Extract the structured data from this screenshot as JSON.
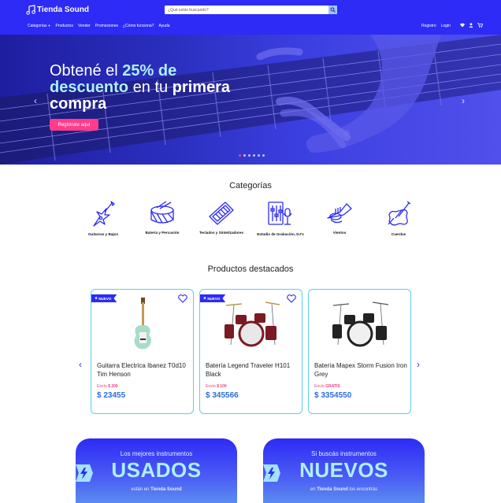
{
  "header": {
    "logo_text": "Tienda Sound",
    "search_placeholder": "¿Qué estás buscando?",
    "nav": [
      "Categorías",
      "Productos",
      "Vender",
      "Promociones",
      "¿Cómo funciona?",
      "Ayuda"
    ],
    "register": "Registro",
    "login": "Login"
  },
  "hero": {
    "line1_a": "Obtené el ",
    "line1_b": "25% de",
    "line2_a": "descuento",
    "line2_b": " en tu ",
    "line2_c": "primera",
    "line3": "compra",
    "button": "Registrate aquí",
    "slides": 6,
    "active_slide": 1
  },
  "categories": {
    "title": "Categorías",
    "items": [
      {
        "label": "Guitarras y Bajos",
        "icon": "guitar-icon"
      },
      {
        "label": "Batería y Percusión",
        "icon": "drum-icon"
      },
      {
        "label": "Teclados y Sintetizadores",
        "icon": "keyboard-icon"
      },
      {
        "label": "Estudio de Grabación, DJ's",
        "icon": "mixer-icon"
      },
      {
        "label": "Vientos",
        "icon": "trumpet-icon"
      },
      {
        "label": "Cuerdas",
        "icon": "violin-icon"
      }
    ]
  },
  "products": {
    "title": "Productos destacados",
    "items": [
      {
        "badge": "NUEVO",
        "name": "Guitarra Electrica Ibanez T0d10 Tim Henson",
        "ship_label": "Envío",
        "ship_value": "$ 200",
        "price": "$ 23455",
        "image": "guitar-photo"
      },
      {
        "badge": "NUEVO",
        "name": "Batería Legend Traveler H101 Black",
        "ship_label": "Envío",
        "ship_value": "$ 100",
        "price": "$ 345566",
        "image": "drum-kit-red-photo"
      },
      {
        "badge": "",
        "name": "Batería Mapex Storm Fusion Iron Grey",
        "ship_label": "Envío",
        "ship_value": "GRATIS",
        "price": "$ 3354550",
        "image": "drum-kit-black-photo"
      }
    ]
  },
  "promos": [
    {
      "top": "Los mejores instrumentos",
      "big": "USADOS",
      "bottom_a": "están en ",
      "bottom_b": "Tienda Sound",
      "bottom_c": ""
    },
    {
      "top": "Si buscás instrumentos",
      "big": "NUEVOS",
      "bottom_a": "en ",
      "bottom_b": "Tienda Sound",
      "bottom_c": " los encontrás"
    }
  ],
  "colors": {
    "brand": "#2d2bf5",
    "accent": "#ff3d8b",
    "highlight": "#aef0ff",
    "card_border": "#5ad0e8",
    "price": "#2d6cdf"
  }
}
